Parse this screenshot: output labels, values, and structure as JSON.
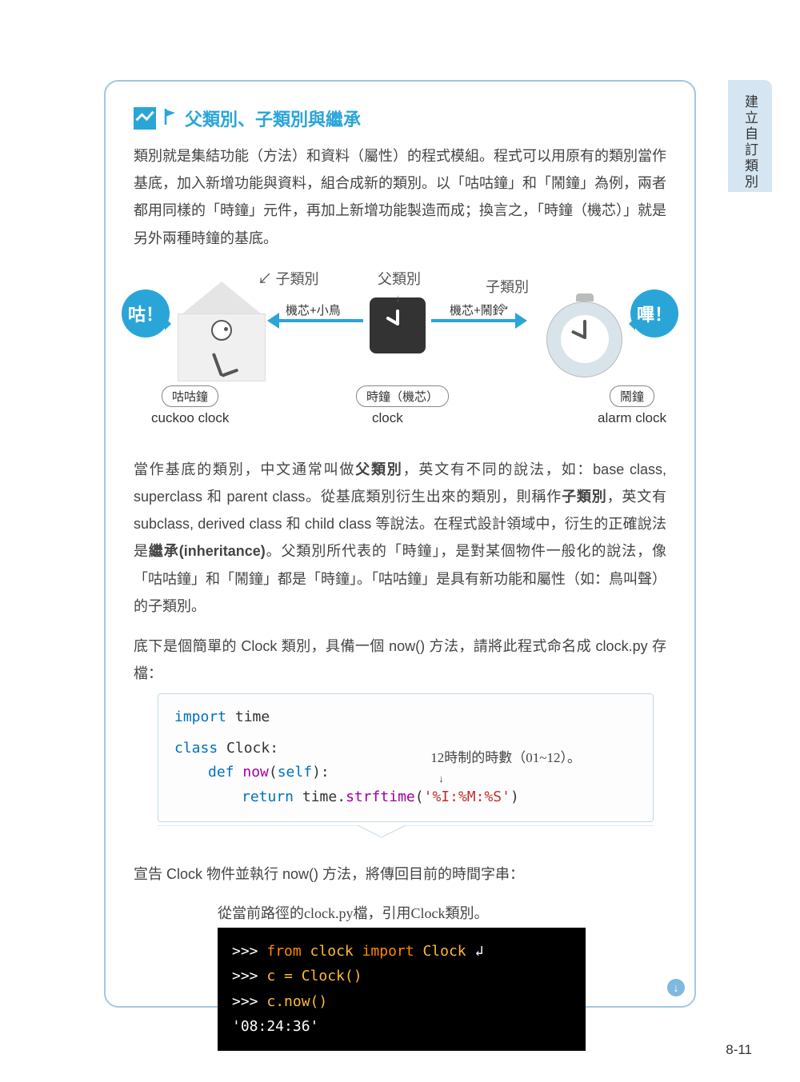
{
  "sideTab": "建立自訂類別",
  "sectionTitle": "父類別、子類別與繼承",
  "para1": "類別就是集結功能（方法）和資料（屬性）的程式模組。程式可以用原有的類別當作基底，加入新增功能與資料，組合成新的類別。以「咕咕鐘」和「鬧鐘」為例，兩者都用同樣的「時鐘」元件，再加上新增功能製造而成；換言之，「時鐘（機芯）」就是另外兩種時鐘的基底。",
  "diagram": {
    "bubbleLeft": "咕！",
    "bubbleRight": "嗶！",
    "handLeft": "子類別",
    "handCenter": "父類別",
    "handRight": "子類別",
    "arrowLeftLabel": "機芯+小鳥",
    "arrowRightLabel": "機芯+鬧鈴",
    "pillLeft": "咕咕鐘",
    "pillCenter": "時鐘（機芯）",
    "pillRight": "鬧鐘",
    "enLeft": "cuckoo clock",
    "enCenter": "clock",
    "enRight": "alarm clock"
  },
  "para2_pre": "當作基底的類別，中文通常叫做",
  "para2_b1": "父類別",
  "para2_mid1": "，英文有不同的說法，如：base class, superclass 和 parent class。從基底類別衍生出來的類別，則稱作",
  "para2_b2": "子類別",
  "para2_mid2": "，英文有 subclass, derived class 和 child class 等說法。在程式設計領域中，衍生的正確說法是",
  "para2_b3": "繼承(inheritance)",
  "para2_post": "。父類別所代表的「時鐘」，是對某個物件一般化的說法，像「咕咕鐘」和「鬧鐘」都是「時鐘」。「咕咕鐘」是具有新功能和屬性（如：鳥叫聲）的子類別。",
  "para3": "底下是個簡單的 Clock 類別，具備一個 now() 方法，請將此程式命名成 clock.py 存檔：",
  "code1": {
    "l1a": "import",
    "l1b": " time",
    "l2a": "class",
    "l2b": " Clock:",
    "l3a": "def",
    "l3b": " ",
    "l3c": "now",
    "l3d": "(",
    "l3e": "self",
    "l3f": "):",
    "l4a": "return",
    "l4b": " time.",
    "l4c": "strftime",
    "l4d": "(",
    "l4e": "'%I:%M:%S'",
    "l4f": ")",
    "annot": "12時制的時數（01~12）。"
  },
  "para4": "宣告 Clock 物件並執行 now() 方法，將傳回目前的時間字串：",
  "termAnnot": "從當前路徑的clock.py檔，引用Clock類別。",
  "terminal": {
    "l1a": ">>> ",
    "l1b": "from",
    "l1c": " clock ",
    "l1d": "import",
    "l1e": " Clock",
    "l2a": ">>> ",
    "l2b": "c = Clock()",
    "l3a": ">>> ",
    "l3b": "c.now()",
    "l4": "'08:24:36'"
  },
  "pageNum": "8-11"
}
